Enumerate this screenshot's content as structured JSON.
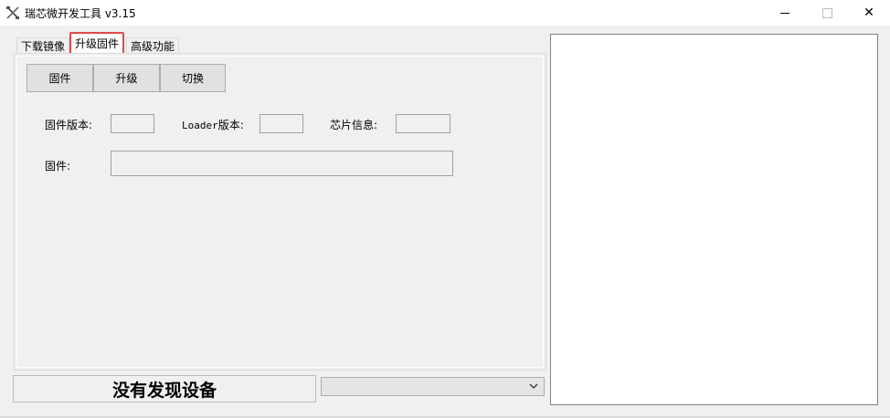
{
  "window": {
    "title": "瑞芯微开发工具 v3.15"
  },
  "titlebar": {
    "minimize_icon": "minimize-icon",
    "maximize_icon": "maximize-icon",
    "close_icon": "close-icon",
    "close_glyph": "✕"
  },
  "tabs": [
    {
      "label": "下载镜像"
    },
    {
      "label": "升级固件",
      "selected": true,
      "highlight_color": "#e04a4a"
    },
    {
      "label": "高级功能"
    }
  ],
  "toolbar": {
    "firmware_label": "固件",
    "upgrade_label": "升级",
    "switch_label": "切换"
  },
  "info": {
    "firmware_version_label": "固件版本:",
    "loader_version_label_en": "Loader",
    "loader_version_label_cn": "版本:",
    "chip_info_label": "芯片信息:",
    "firmware_path_label": "固件:",
    "firmware_version_value": "",
    "loader_version_value": "",
    "chip_info_value": "",
    "firmware_path_value": ""
  },
  "status": {
    "text": "没有发现设备"
  },
  "device_select": {
    "value": ""
  },
  "colors": {
    "window_bg": "#f0f0f0",
    "button_bg": "#e1e1e1",
    "highlight": "#e04a4a"
  }
}
